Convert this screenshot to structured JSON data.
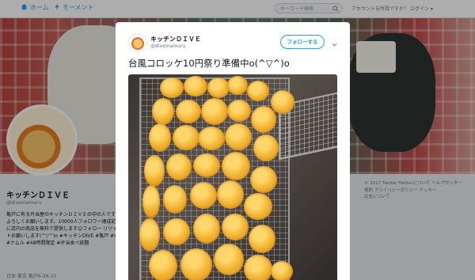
{
  "topbar": {
    "home_label": "ホーム",
    "moments_label": "モーメント",
    "search_placeholder": "キーワード検索",
    "account_text": "アカウントを所持ですか？ ログイン ▾"
  },
  "profile": {
    "name": "キッチンＤＩＶＥ",
    "handle": "@divemamuru",
    "bio": "亀戸に有る弁当屋のキッチンＤＩＶＥの中の人です😉よろしくお願いします。10000人フォロワー達成記念に店内の商品を無料で提供します😊フォロー リツイートお願いします(^▽^)o #キッチンDIVE #亀戸 #弁当 #ナムル #48時間限定 #弁当食べ放題",
    "location": "日本 東京 亀戸6-36-10"
  },
  "footer": {
    "line1": "© 2017 Twitter  Twitterについて  ヘルプセンター",
    "line2": "規約  プライバシーポリシー  クッキー",
    "line3": "広告について"
  },
  "tweet": {
    "author_name": "キッチンＤＩＶＥ",
    "author_handle": "@divemamuru",
    "follow_label": "フォローする",
    "text": "台風コロッケ10円祭り準備中o(^▽^)o"
  },
  "colors": {
    "accent": "#1da1f2",
    "text": "#14171a",
    "muted": "#657786"
  },
  "icons": {
    "home": "home-icon",
    "moments": "lightning-icon",
    "search": "search-icon",
    "caret": "chevron-down-icon"
  }
}
